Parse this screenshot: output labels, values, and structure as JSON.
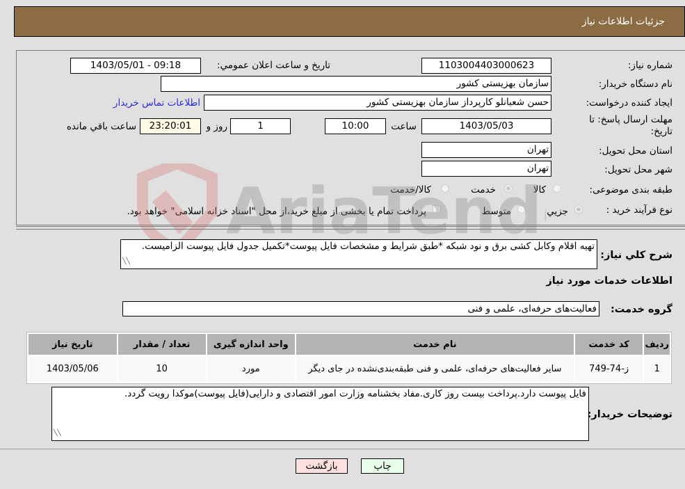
{
  "header": {
    "title": "جزئیات اطلاعات نیاز"
  },
  "form": {
    "need_number": {
      "label": "شماره نیاز:",
      "value": "1103004403000623"
    },
    "announce_datetime": {
      "label": "تاریخ و ساعت اعلان عمومي:",
      "value": "1403/05/01 - 09:18"
    },
    "buyer_org": {
      "label": "نام دستگاه خریدار:",
      "value": "سازمان بهزیستی کشور"
    },
    "requester": {
      "label": "ایجاد کننده درخواست:",
      "value": "حسن  شعبانلو کارپرداز سازمان بهزیستی کشور"
    },
    "buyer_contact_link": "اطلاعات تماس خریدار",
    "deadline": {
      "label_line1": "مهلت ارسال پاسخ: تا",
      "label_line2": "تاریخ:",
      "date": "1403/05/03",
      "time_label": "ساعت",
      "time": "10:00",
      "days": "1",
      "days_label": "روز و",
      "remaining": "23:20:01",
      "remaining_label": "ساعت باقي مانده"
    },
    "province": {
      "label": "استان محل تحویل:",
      "value": "تهران"
    },
    "city": {
      "label": "شهر محل تحویل:",
      "value": "تهران"
    },
    "category": {
      "label": "طبقه بندی موضوعی:",
      "options": [
        "کالا",
        "خدمت",
        "کالا/خدمت"
      ],
      "selected": "خدمت"
    },
    "purchase_type": {
      "label": "نوع فرآیند خرید :",
      "options": [
        "جزيي",
        "متوسط"
      ],
      "selected": "جزيي",
      "treasury_note": "پرداخت تمام یا بخشی از مبلغ خرید،از محل \"اسناد خزانه اسلامی\" خواهد بود."
    }
  },
  "description": {
    "label": "شرح کلي نیاز:",
    "value": "تهیه اقلام وکابل کشی برق و نود شبکه *طبق شرایط و مشخصات فایل پیوست*تکمیل جدول فایل پیوست الزامیست."
  },
  "services_section": {
    "title": "اطلاعات خدمات مورد نیاز",
    "group_label": "گروه خدمت:",
    "group_value": "فعالیت‌های حرفه‌ای، علمی و فنی"
  },
  "table": {
    "headers": [
      "ردیف",
      "کد خدمت",
      "نام خدمت",
      "واحد اندازه گیری",
      "تعداد / مقدار",
      "تاریخ نیاز"
    ],
    "rows": [
      [
        "1",
        "ز-74-749",
        "سایر فعالیت‌های حرفه‌ای، علمی و فنی طبقه‌بندی‌نشده در جای دیگر",
        "مورد",
        "10",
        "1403/05/06"
      ]
    ]
  },
  "buyer_notes": {
    "label": "توضیحات خریدار:",
    "value": "فایل پیوست دارد.پرداخت بیست روز کاری.مفاد بخشنامه وزارت امور اقتصادی و دارایی(فایل پیوست)موکدا رویت گردد."
  },
  "buttons": {
    "print": "چاپ",
    "back": "بازگشت"
  },
  "watermark": {
    "text": "AriaTender.neT"
  }
}
